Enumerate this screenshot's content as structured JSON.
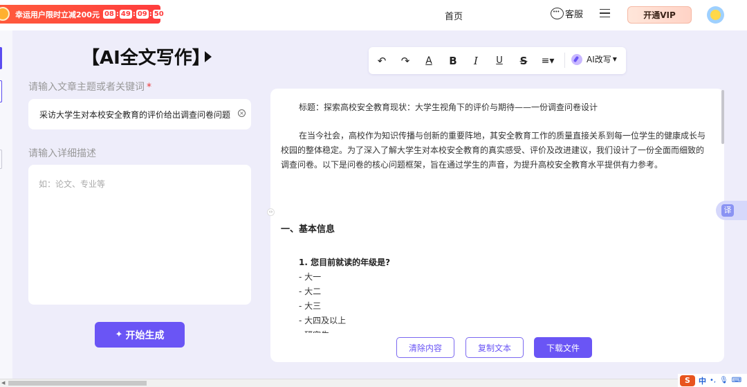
{
  "promo": {
    "text": "幸运用户限时立减200元",
    "timer": [
      "08",
      "49",
      "09",
      "50"
    ]
  },
  "header": {
    "home": "首页",
    "service": "客服",
    "vip": "开通VIP"
  },
  "left": {
    "title": "【AI全文写作】",
    "topic_label": "请输入文章主题或者关键词",
    "required_mark": "*",
    "topic_value": "采访大学生对本校安全教育的评价给出调查问卷问题",
    "detail_label": "请输入详细描述",
    "detail_placeholder": "如：论文、专业等",
    "generate": "开始生成"
  },
  "toolbar": {
    "undo": "↶",
    "redo": "↷",
    "font_color": "A",
    "bold": "B",
    "italic": "I",
    "underline": "U",
    "strike": "S",
    "ai_rewrite": "AI改写"
  },
  "document": {
    "title": "标题：探索高校安全教育现状：大学生视角下的评价与期待——一份调查问卷设计",
    "intro": "在当今社会，高校作为知识传播与创新的重要阵地，其安全教育工作的质量直接关系到每一位学生的健康成长与校园的整体稳定。为了深入了解大学生对本校安全教育的真实感受、评价及改进建议，我们设计了一份全面而细致的调查问卷。以下是问卷的核心问题框架，旨在通过学生的声音，为提升高校安全教育水平提供有力参考。",
    "section1": "一、基本信息",
    "q1": "1. 您目前就读的年级是?",
    "options": [
      "- 大一",
      "- 大二",
      "- 大三",
      "- 大四及以上",
      "- 研究生"
    ]
  },
  "actions": {
    "clear": "清除内容",
    "copy": "复制文本",
    "download": "下载文件"
  },
  "side": {
    "translate": "译"
  },
  "ime": {
    "logo": "S",
    "lang": "中"
  },
  "colors": {
    "accent": "#6a55f5",
    "promo": "#ff3d3d",
    "background": "#eeedfa"
  }
}
